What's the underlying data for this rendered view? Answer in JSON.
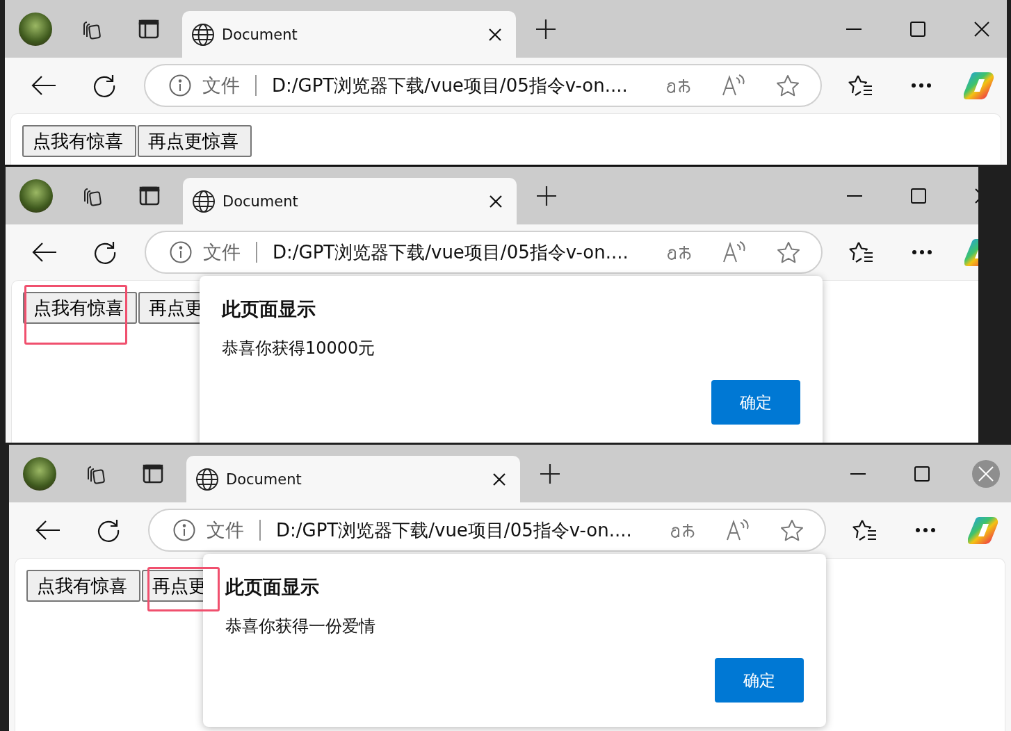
{
  "windows": [
    {
      "tab_title": "Document",
      "scheme_label": "文件",
      "url": "D:/GPT浏览器下载/vue项目/05指令v-on....",
      "close_hovered": false,
      "buttons": [
        {
          "label": "点我有惊喜",
          "highlighted": false
        },
        {
          "label": "再点更惊喜",
          "highlighted": false
        }
      ]
    },
    {
      "tab_title": "Document",
      "scheme_label": "文件",
      "url": "D:/GPT浏览器下载/vue项目/05指令v-on....",
      "close_hovered": false,
      "buttons": [
        {
          "label": "点我有惊喜",
          "highlighted": true
        },
        {
          "label": "再点更",
          "highlighted": false
        }
      ],
      "dialog": {
        "title": "此页面显示",
        "message": "恭喜你获得10000元",
        "ok": "确定"
      }
    },
    {
      "tab_title": "Document",
      "scheme_label": "文件",
      "url": "D:/GPT浏览器下载/vue项目/05指令v-on....",
      "close_hovered": true,
      "buttons": [
        {
          "label": "点我有惊喜",
          "highlighted": false
        },
        {
          "label": "再点更",
          "highlighted": true
        }
      ],
      "dialog": {
        "title": "此页面显示",
        "message": "恭喜你获得一份爱情",
        "ok": "确定"
      }
    }
  ]
}
